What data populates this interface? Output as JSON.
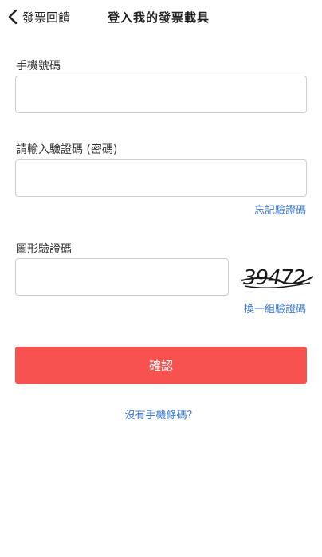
{
  "header": {
    "back_label": "發票回饋",
    "title": "登入我的發票載具"
  },
  "phone": {
    "label": "手機號碼",
    "value": "",
    "placeholder": ""
  },
  "verify_code": {
    "label": "請輸入驗證碼 (密碼)",
    "value": "",
    "placeholder": "",
    "forgot_link": "忘記驗證碼"
  },
  "captcha": {
    "label": "圖形驗證碼",
    "value": "",
    "placeholder": "",
    "image_text": "39472",
    "refresh_link": "換一組驗證碼"
  },
  "confirm_label": "確認",
  "no_barcode_link": "沒有手機條碼？",
  "colors": {
    "accent_red": "#f75250",
    "link_blue": "#3a78d6"
  },
  "icons": {
    "back": "chevron-left-icon"
  }
}
